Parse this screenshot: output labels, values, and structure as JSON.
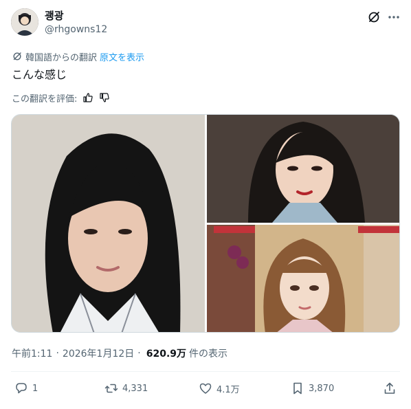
{
  "author": {
    "display_name": "괭광",
    "handle": "@rhgowns12"
  },
  "translation": {
    "label": "韓国語からの翻訳",
    "show_original": "原文を表示"
  },
  "tweet": {
    "text": "こんな感じ"
  },
  "rating": {
    "label": "この翻訳を評価:"
  },
  "meta": {
    "time": "午前1:11",
    "separator": "·",
    "date": "2026年1月12日",
    "separator2": "·",
    "views_count": "620.9万",
    "views_label": "件の表示"
  },
  "actions": {
    "replies": "1",
    "retweets": "4,331",
    "likes": "4.1万",
    "bookmarks": "3,870"
  },
  "icons": {
    "grok": "grok-icon",
    "more": "more-icon",
    "reply": "reply-icon",
    "retweet": "retweet-icon",
    "like": "heart-icon",
    "bookmark": "bookmark-icon",
    "share": "share-icon"
  },
  "colors": {
    "link": "#1d9bf0",
    "secondary_text": "#536471",
    "primary_text": "#0f1419"
  }
}
